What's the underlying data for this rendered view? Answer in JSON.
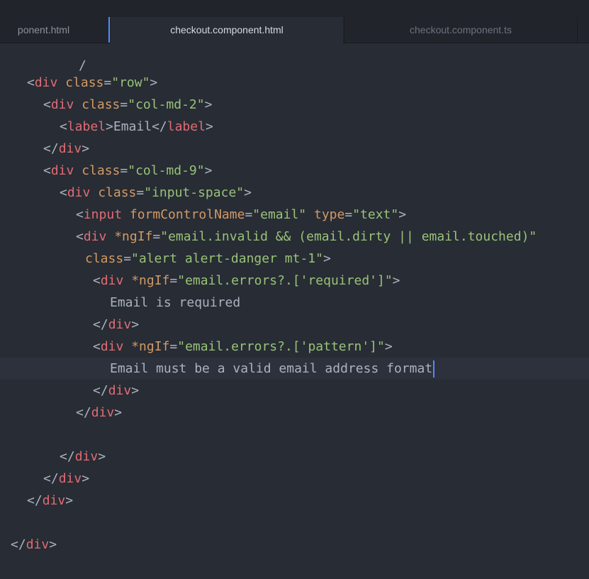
{
  "tabs": [
    {
      "label": "ponent.html"
    },
    {
      "label": "checkout.component.html"
    },
    {
      "label": "checkout.component.ts"
    },
    {
      "label": ""
    }
  ],
  "code": {
    "l0": {
      "text": "/"
    },
    "l1": {
      "a": "<",
      "b": "div",
      "c": " ",
      "d": "class",
      "e": "=",
      "f": "\"row\"",
      "g": ">"
    },
    "l2": {
      "a": "<",
      "b": "div",
      "c": " ",
      "d": "class",
      "e": "=",
      "f": "\"col-md-2\"",
      "g": ">"
    },
    "l3": {
      "a": "<",
      "b": "label",
      "c": ">",
      "d": "Email",
      "e": "</",
      "f": "label",
      "g": ">"
    },
    "l4": {
      "a": "</",
      "b": "div",
      "c": ">"
    },
    "l5": {
      "a": "<",
      "b": "div",
      "c": " ",
      "d": "class",
      "e": "=",
      "f": "\"col-md-9\"",
      "g": ">"
    },
    "l6": {
      "a": "<",
      "b": "div",
      "c": " ",
      "d": "class",
      "e": "=",
      "f": "\"input-space\"",
      "g": ">"
    },
    "l7": {
      "a": "<",
      "b": "input",
      "c": " ",
      "d": "formControlName",
      "e": "=",
      "f": "\"email\"",
      "g": " ",
      "h": "type",
      "i": "=",
      "j": "\"text\"",
      "k": ">"
    },
    "l8": {
      "a": "<",
      "b": "div",
      "c": " ",
      "d": "*ngIf",
      "e": "=",
      "f": "\"email.invalid && (email.dirty || email.touched)\""
    },
    "l9": {
      "a": "class",
      "b": "=",
      "c": "\"alert alert-danger mt-1\"",
      "d": ">"
    },
    "l10": {
      "a": "<",
      "b": "div",
      "c": " ",
      "d": "*ngIf",
      "e": "=",
      "f": "\"email.errors?.['required']\"",
      "g": ">"
    },
    "l11": {
      "text": "Email is required"
    },
    "l12": {
      "a": "</",
      "b": "div",
      "c": ">"
    },
    "l13": {
      "a": "<",
      "b": "div",
      "c": " ",
      "d": "*ngIf",
      "e": "=",
      "f": "\"email.errors?.['pattern']\"",
      "g": ">"
    },
    "l14": {
      "text": "Email must be a valid email address format"
    },
    "l15": {
      "a": "</",
      "b": "div",
      "c": ">"
    },
    "l16": {
      "a": "</",
      "b": "div",
      "c": ">"
    },
    "l17": {
      "a": "</",
      "b": "div",
      "c": ">"
    },
    "l18": {
      "a": "</",
      "b": "div",
      "c": ">"
    },
    "l19": {
      "a": "</",
      "b": "div",
      "c": ">"
    },
    "l20": {
      "a": "</",
      "b": "div",
      "c": ">"
    }
  },
  "colors": {
    "background": "#282c34",
    "tag": "#e06c75",
    "attribute": "#d19a66",
    "string": "#98c379",
    "text": "#abb2bf",
    "cursor": "#528bff"
  }
}
